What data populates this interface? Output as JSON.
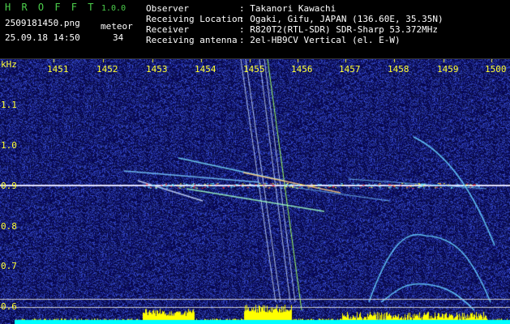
{
  "app": {
    "name": "H R O F F T",
    "version": "1.0.0"
  },
  "file": {
    "name": "2509181450.png",
    "datetime": "25.09.18 14:50"
  },
  "meteor": {
    "label": "meteor",
    "count": "34"
  },
  "info": {
    "rows": [
      {
        "label": "Observer",
        "value": ": Takanori Kawachi"
      },
      {
        "label": "Receiving Location",
        "value": ": Ogaki, Gifu, JAPAN (136.60E, 35.35N)"
      },
      {
        "label": "Receiver",
        "value": ": R820T2(RTL-SDR) SDR-Sharp 53.372MHz"
      },
      {
        "label": "Receiving antenna",
        "value": ": 2el-HB9CV Vertical (el. E-W)"
      }
    ]
  },
  "spectrogram": {
    "x_unit": "kHz",
    "x_ticks": [
      "1451",
      "1452",
      "1453",
      "1454",
      "1455",
      "1456",
      "1457",
      "1458",
      "1459",
      "1500"
    ],
    "y_ticks": [
      "1.1",
      "1.0",
      "0.9",
      "0.8",
      "0.7",
      "0.6"
    ],
    "carrier_khz": 0.9,
    "colors": {
      "background": "#0a0a4a",
      "noise": "#2a3ac0",
      "carrier": "#e0e0ff",
      "echo_hot": "#ff3030",
      "echo_warm": "#ffff40",
      "echo_cool": "#60e0ff",
      "histogram": "#ffff00",
      "histogram_base": "#00ffff"
    }
  }
}
